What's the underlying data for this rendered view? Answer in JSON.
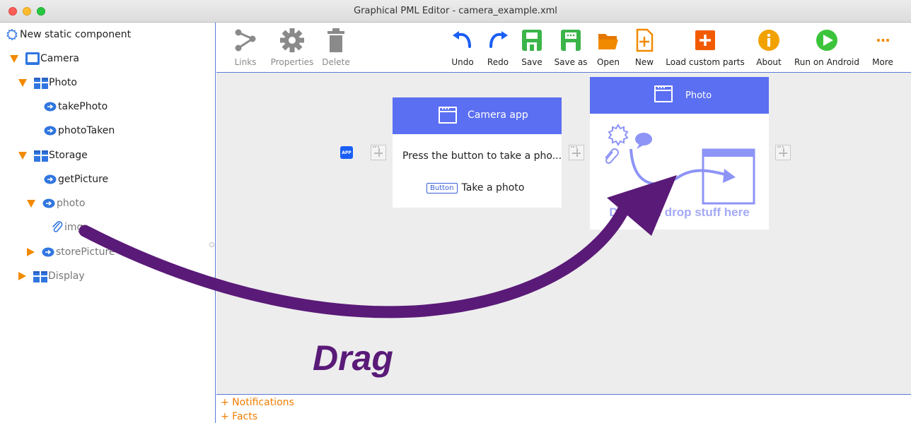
{
  "window": {
    "title": "Graphical PML Editor - camera_example.xml"
  },
  "tree": {
    "root_label": "New static component",
    "items": [
      {
        "label": "Camera"
      },
      {
        "label": "Photo"
      },
      {
        "label": "takePhoto"
      },
      {
        "label": "photoTaken"
      },
      {
        "label": "Storage"
      },
      {
        "label": "getPicture"
      },
      {
        "label": "photo"
      },
      {
        "label": "img"
      },
      {
        "label": "storePicture"
      },
      {
        "label": "Display"
      }
    ]
  },
  "toolbar": {
    "links": "Links",
    "properties": "Properties",
    "delete": "Delete",
    "undo": "Undo",
    "redo": "Redo",
    "save": "Save",
    "save_as": "Save as",
    "open": "Open",
    "new": "New",
    "load_custom_parts": "Load custom parts",
    "about": "About",
    "run_on_android": "Run on Android",
    "more": "More",
    "more_glyph": "···"
  },
  "canvas": {
    "app_badge": "APP",
    "camera_card": {
      "title": "Camera app",
      "text": "Press the button to take a pho...",
      "button_badge": "Button",
      "button_text": "Take a photo"
    },
    "photo_card": {
      "title": "Photo",
      "drop_hint": "Drag and drop stuff here"
    }
  },
  "bottom": {
    "notifications": "+ Notifications",
    "facts": "+ Facts"
  },
  "overlay": {
    "drag_label": "Drag"
  },
  "colors": {
    "accent_blue": "#5b6ff2",
    "tree_arrow": "#f28a00",
    "save_green": "#3bb54a",
    "open_orange": "#f28a00",
    "drag_purple": "#5a1a78"
  }
}
